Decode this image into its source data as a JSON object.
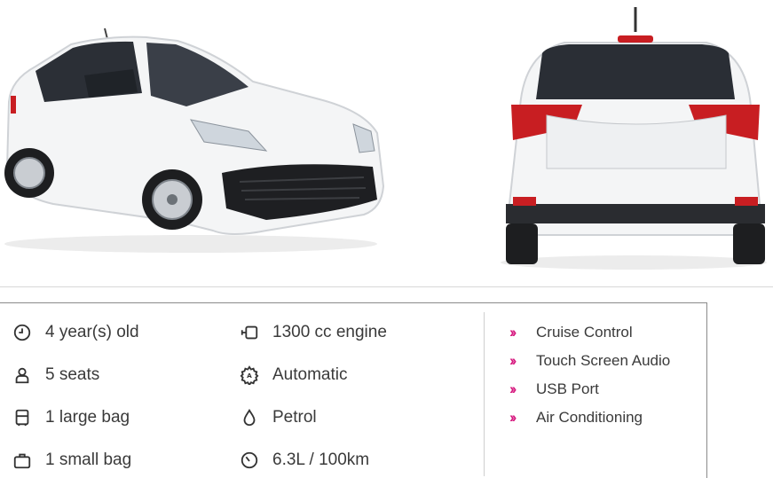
{
  "specs": {
    "col1": [
      {
        "icon": "clock-icon",
        "label": "4 year(s) old"
      },
      {
        "icon": "person-icon",
        "label": "5 seats"
      },
      {
        "icon": "suitcase-icon",
        "label": "1 large bag"
      },
      {
        "icon": "bag-icon",
        "label": "1 small bag"
      }
    ],
    "col2": [
      {
        "icon": "engine-icon",
        "label": "1300 cc engine"
      },
      {
        "icon": "gear-icon",
        "label": "Automatic"
      },
      {
        "icon": "fuel-drop-icon",
        "label": "Petrol"
      },
      {
        "icon": "gauge-icon",
        "label": "6.3L / 100km"
      }
    ]
  },
  "features": [
    {
      "label": "Cruise Control"
    },
    {
      "label": "Touch Screen Audio"
    },
    {
      "label": "USB Port"
    },
    {
      "label": "Air Conditioning"
    }
  ],
  "colors": {
    "accent": "#d6197f",
    "car_body": "#f4f5f6",
    "tail_light": "#c81e22"
  }
}
